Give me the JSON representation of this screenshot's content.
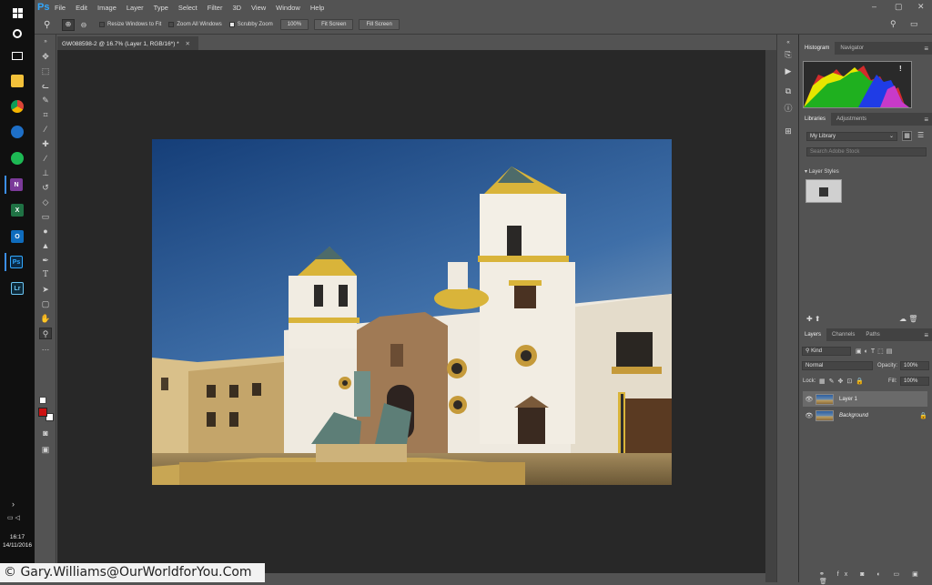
{
  "menubar": {
    "logo": "Ps",
    "items": [
      "File",
      "Edit",
      "Image",
      "Layer",
      "Type",
      "Select",
      "Filter",
      "3D",
      "View",
      "Window",
      "Help"
    ]
  },
  "options": {
    "resize_windows": "Resize Windows to Fit",
    "zoom_all": "Zoom All Windows",
    "scrubby": "Scrubby Zoom",
    "zoom_value": "100%",
    "fit_screen": "Fit Screen",
    "fill_screen": "Fill Screen"
  },
  "document": {
    "tab_title": "GW088598-2 @ 16.7% (Layer 1, RGB/16*) *"
  },
  "histogram": {
    "tabs": [
      "Histogram",
      "Navigator"
    ],
    "warning": "!"
  },
  "libraries": {
    "tabs": [
      "Libraries",
      "Adjustments"
    ],
    "library_name": "My Library",
    "search_placeholder": "Search Adobe Stock",
    "section": "Layer Styles"
  },
  "layers": {
    "tabs": [
      "Layers",
      "Channels",
      "Paths"
    ],
    "filter_kind": "Kind",
    "blend_mode": "Normal",
    "opacity_label": "Opacity:",
    "opacity": "100%",
    "lock_label": "Lock:",
    "fill_label": "Fill:",
    "fill": "100%",
    "items": [
      {
        "name": "Layer 1"
      },
      {
        "name": "Background"
      }
    ]
  },
  "taskbar": {
    "time": "16:17",
    "date": "14/11/2016"
  },
  "watermark": "© Gary.Williams@OurWorldforYou.Com",
  "colors": {
    "ps_blue": "#31a8ff",
    "foreground": "#cc1111",
    "background": "#ffffff"
  }
}
